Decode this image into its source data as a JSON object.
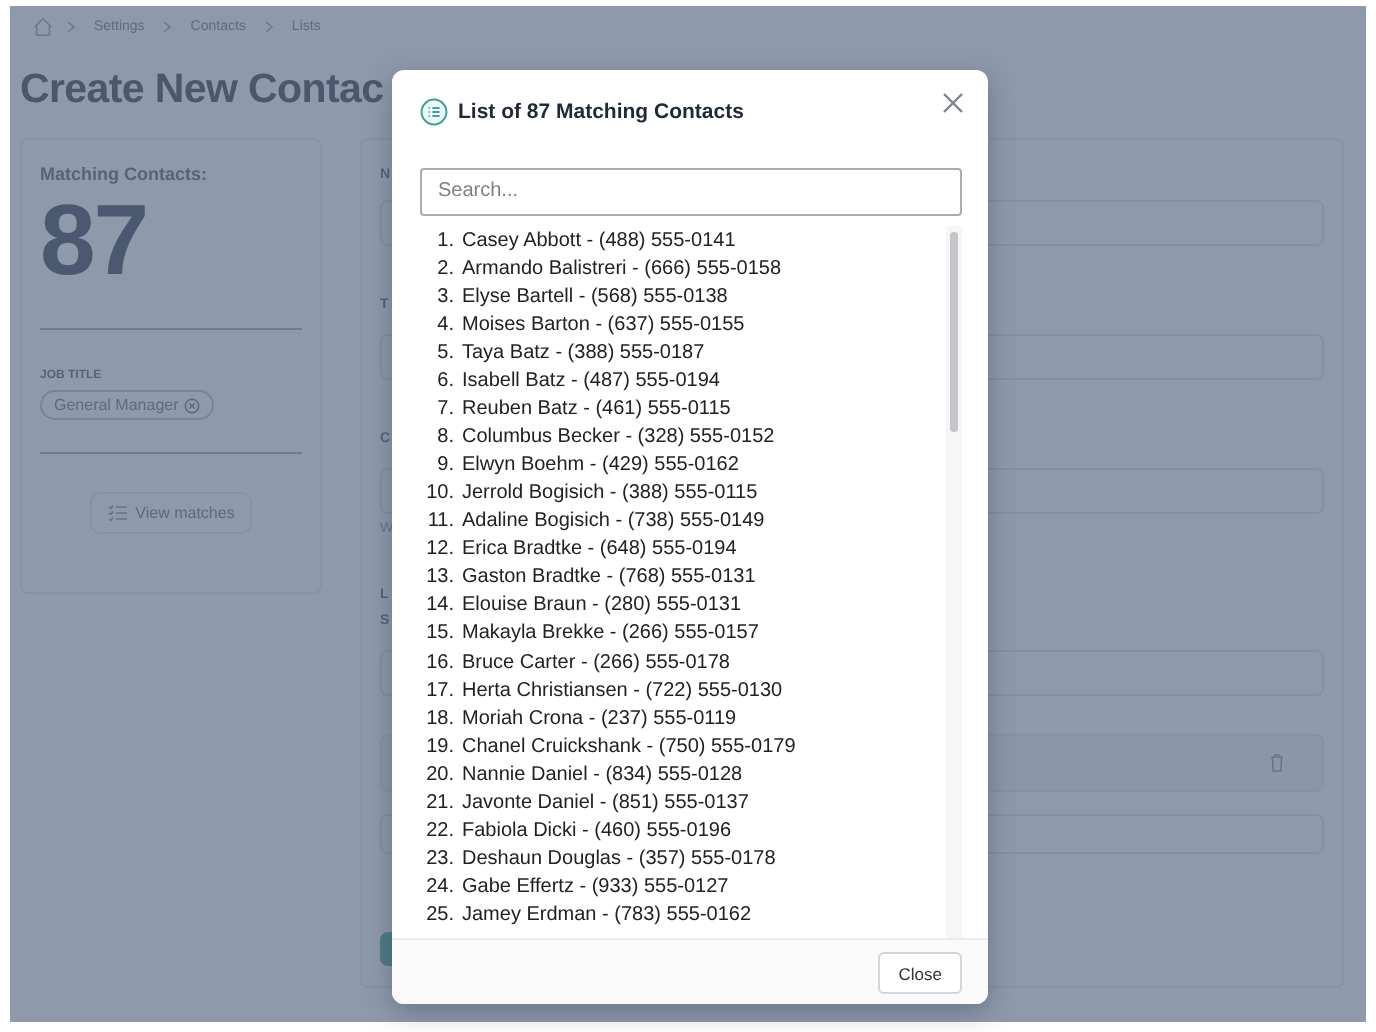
{
  "breadcrumb": [
    "Settings",
    "Contacts",
    "Lists"
  ],
  "page_title": "Create New Contac",
  "summary_card": {
    "label": "Matching Contacts:",
    "count": "87",
    "filter_heading": "JOB TITLE",
    "filter_chips": [
      "General Manager"
    ],
    "view_button": "View matches"
  },
  "form_card": {
    "items": [
      {
        "kind": "field",
        "label": "N"
      },
      {
        "kind": "field",
        "label": "T"
      },
      {
        "kind": "field",
        "label": "C",
        "hint": "W"
      },
      {
        "kind": "heading",
        "label": "L"
      },
      {
        "kind": "field",
        "label": "S"
      },
      {
        "kind": "row"
      },
      {
        "kind": "box"
      },
      {
        "kind": "button"
      }
    ]
  },
  "modal": {
    "title": "List of 87 Matching Contacts",
    "search": {
      "placeholder": "Search..."
    },
    "contacts": [
      {
        "number": "1.",
        "text": "Casey Abbott - (488) 555-0141"
      },
      {
        "number": "2.",
        "text": "Armando Balistreri - (666) 555-0158"
      },
      {
        "number": "3.",
        "text": "Elyse Bartell - (568) 555-0138"
      },
      {
        "number": "4.",
        "text": "Moises Barton - (637) 555-0155"
      },
      {
        "number": "5.",
        "text": "Taya Batz - (388) 555-0187"
      },
      {
        "number": "6.",
        "text": "Isabell Batz - (487) 555-0194"
      },
      {
        "number": "7.",
        "text": "Reuben Batz - (461) 555-0115"
      },
      {
        "number": "8.",
        "text": "Columbus Becker - (328) 555-0152"
      },
      {
        "number": "9.",
        "text": "Elwyn Boehm - (429) 555-0162"
      },
      {
        "number": "10.",
        "text": "Jerrold Bogisich - (388) 555-0115"
      },
      {
        "number": "11.",
        "text": "Adaline Bogisich - (738) 555-0149"
      },
      {
        "number": "12.",
        "text": "Erica Bradtke - (648) 555-0194"
      },
      {
        "number": "13.",
        "text": "Gaston Bradtke - (768) 555-0131"
      },
      {
        "number": "14.",
        "text": "Elouise Braun - (280) 555-0131"
      },
      {
        "number": "15.",
        "text": "Makayla Brekke - (266) 555-0157"
      },
      {
        "number": "16.",
        "text": "Bruce Carter - (266) 555-0178"
      },
      {
        "number": "17.",
        "text": "Herta Christiansen - (722) 555-0130"
      },
      {
        "number": "18.",
        "text": "Moriah Crona - (237) 555-0119"
      },
      {
        "number": "19.",
        "text": "Chanel Cruickshank - (750) 555-0179"
      },
      {
        "number": "20.",
        "text": "Nannie Daniel - (834) 555-0128"
      },
      {
        "number": "21.",
        "text": "Javonte Daniel - (851) 555-0137"
      },
      {
        "number": "22.",
        "text": "Fabiola Dicki - (460) 555-0196"
      },
      {
        "number": "23.",
        "text": "Deshaun Douglas - (357) 555-0178"
      },
      {
        "number": "24.",
        "text": "Gabe Effertz - (933) 555-0127"
      },
      {
        "number": "25.",
        "text": "Jamey Erdman - (783) 555-0162"
      }
    ],
    "close_button": "Close"
  }
}
